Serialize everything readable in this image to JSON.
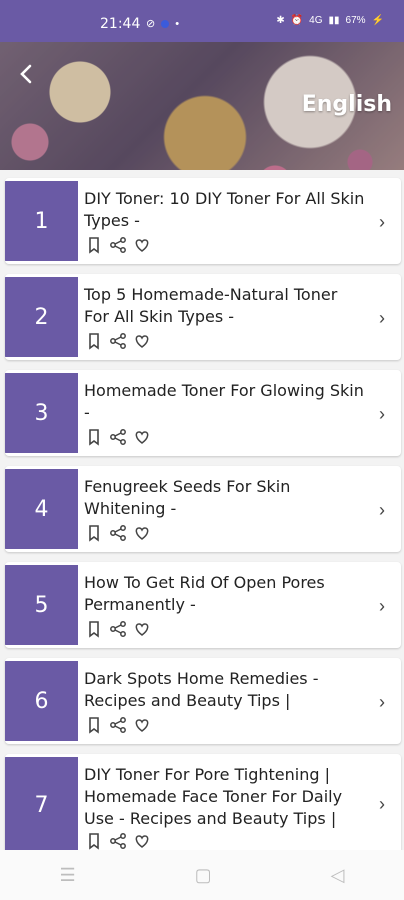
{
  "status_bar": {
    "time": "21:44",
    "battery": "67%",
    "network": "4G"
  },
  "header": {
    "back_icon": "chevron-left-icon",
    "language": "English"
  },
  "items": [
    {
      "number": "1",
      "title": "DIY Toner: 10 DIY Toner For All Skin Types -"
    },
    {
      "number": "2",
      "title": "Top 5 Homemade-Natural Toner For All Skin Types -"
    },
    {
      "number": "3",
      "title": "Homemade Toner For Glowing Skin -"
    },
    {
      "number": "4",
      "title": "Fenugreek Seeds For Skin Whitening -"
    },
    {
      "number": "5",
      "title": "How To Get Rid Of Open Pores Permanently -"
    },
    {
      "number": "6",
      "title": "Dark Spots Home Remedies - Recipes and Beauty Tips |"
    },
    {
      "number": "7",
      "title": "DIY Toner For Pore Tightening | Homemade Face Toner For Daily Use - Recipes and Beauty Tips |"
    }
  ],
  "colors": {
    "accent": "#6a5aa5",
    "card": "#ffffff",
    "background": "#f3f3f3"
  }
}
